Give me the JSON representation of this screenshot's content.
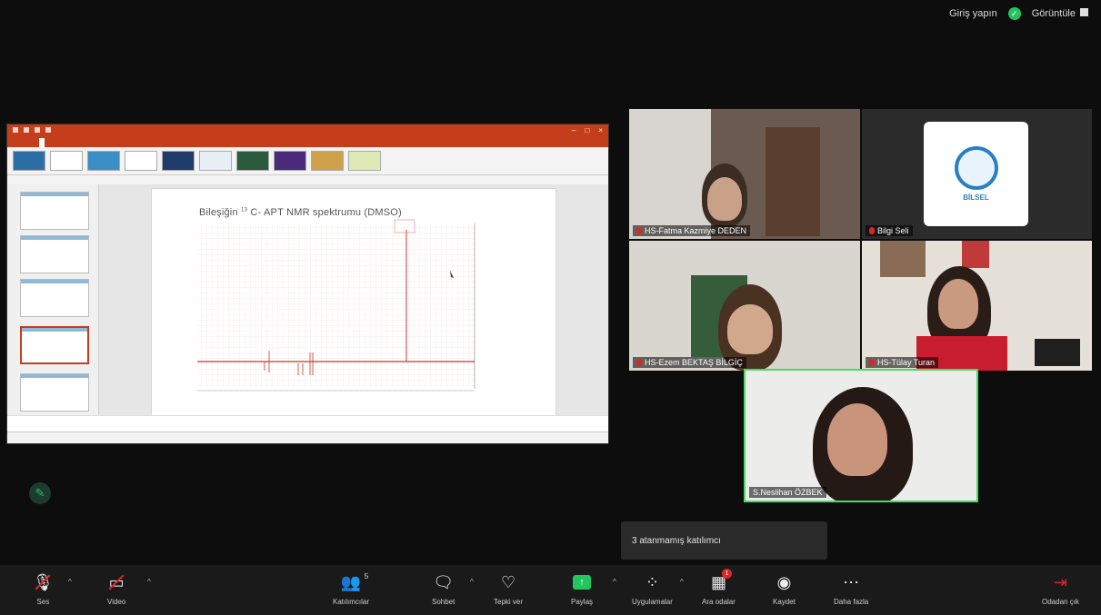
{
  "topbar": {
    "signin": "Giriş yapın",
    "view": "Görüntüle"
  },
  "slide": {
    "title_prefix": "Bileşiğin ",
    "title_sup": "13",
    "title_rest": " C- APT NMR spektrumu (DMSO)"
  },
  "participants": [
    {
      "name": "HS-Fatma Kazmiye DEDEN"
    },
    {
      "name": "Bilgi Seli"
    },
    {
      "name": "HS-Ezem BEKTAŞ BİLGİÇ"
    },
    {
      "name": "HS-Tülay Turan"
    },
    {
      "name": "S.Neslihan ÖZBEK"
    }
  ],
  "logo_text": "BİLSEL",
  "toast": "3 atanmamış katılımcı",
  "toolbar": {
    "audio": "Ses",
    "video": "Video",
    "participants": "Katılımcılar",
    "participants_count": "5",
    "chat": "Sohbet",
    "react": "Tepki ver",
    "share": "Paylaş",
    "apps": "Uygulamalar",
    "breakout": "Ara odalar",
    "breakout_badge": "1",
    "record": "Kaydet",
    "more": "Daha fazla",
    "leave": "Odadan çık"
  },
  "colors": {
    "leave": "#e02424",
    "share": "#23c55e",
    "ppt": "#c43e1c",
    "active_speaker": "#4cd964"
  }
}
